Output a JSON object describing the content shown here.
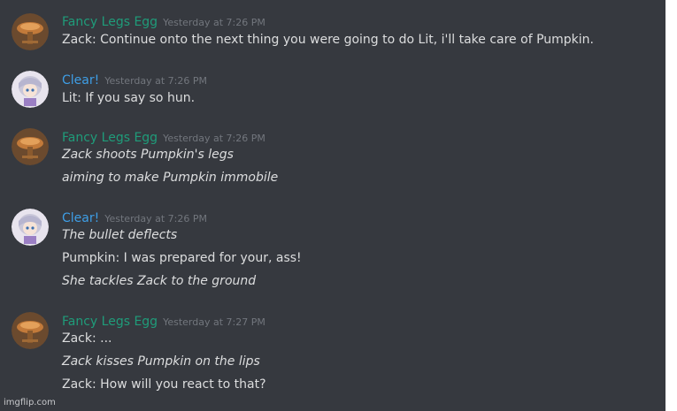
{
  "colors": {
    "background": "#36393f",
    "egg_name": "#1f9c7a",
    "clear_name": "#3e9ee6",
    "timestamp": "#72767d",
    "text": "#dcddde"
  },
  "messages": [
    {
      "author": "Fancy Legs Egg",
      "timestamp": "Yesterday at 7:26 PM",
      "avatar": "pumpkin-table-icon",
      "lines": [
        {
          "text": "Zack: Continue onto the next thing you were going to do Lit, i'll take care of Pumpkin.",
          "italic": false
        }
      ]
    },
    {
      "author": "Clear!",
      "timestamp": "Yesterday at 7:26 PM",
      "avatar": "anime-girl-icon",
      "lines": [
        {
          "text": "Lit: If you say so hun.",
          "italic": false
        }
      ]
    },
    {
      "author": "Fancy Legs Egg",
      "timestamp": "Yesterday at 7:26 PM",
      "avatar": "pumpkin-table-icon",
      "lines": [
        {
          "text": "Zack shoots Pumpkin's legs",
          "italic": true
        },
        {
          "text": "aiming to make Pumpkin immobile",
          "italic": true
        }
      ]
    },
    {
      "author": "Clear!",
      "timestamp": "Yesterday at 7:26 PM",
      "avatar": "anime-girl-icon",
      "lines": [
        {
          "text": "The bullet deflects",
          "italic": true
        },
        {
          "text": "Pumpkin: I was prepared for your, ass!",
          "italic": false
        },
        {
          "text": "She tackles Zack to the ground",
          "italic": true
        }
      ]
    },
    {
      "author": "Fancy Legs Egg",
      "timestamp": "Yesterday at 7:27 PM",
      "avatar": "pumpkin-table-icon",
      "lines": [
        {
          "text": "Zack: ...",
          "italic": false
        },
        {
          "text": "Zack kisses Pumpkin on the lips",
          "italic": true
        },
        {
          "text": "Zack: How will you react to that?",
          "italic": false
        }
      ]
    }
  ],
  "watermark": "imgflip.com"
}
